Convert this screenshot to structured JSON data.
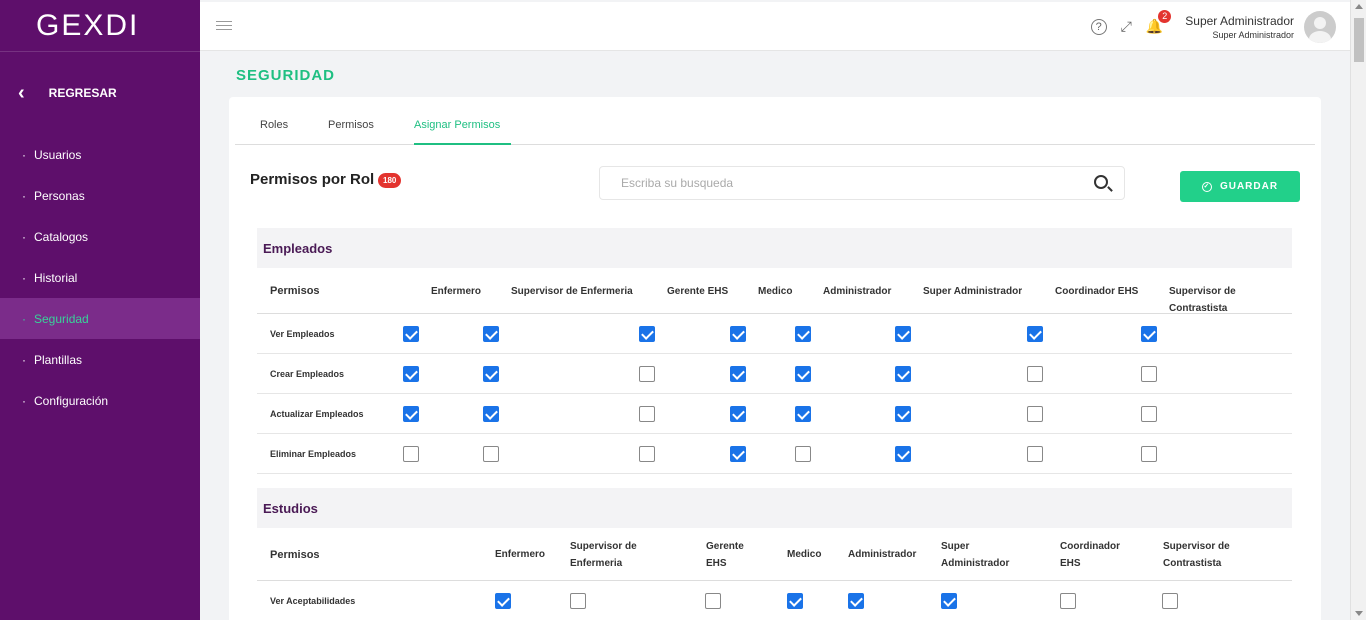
{
  "brand": {
    "logo_text": "GEXDI"
  },
  "sidebar": {
    "back_label": "REGRESAR",
    "items": [
      {
        "label": "Usuarios",
        "active": false
      },
      {
        "label": "Personas",
        "active": false
      },
      {
        "label": "Catalogos",
        "active": false
      },
      {
        "label": "Historial",
        "active": false
      },
      {
        "label": "Seguridad",
        "active": true
      },
      {
        "label": "Plantillas",
        "active": false
      },
      {
        "label": "Configuración",
        "active": false
      }
    ]
  },
  "topbar": {
    "notifications_count": "2",
    "user_name": "Super Administrador",
    "user_role": "Super Administrador"
  },
  "page": {
    "title": "SEGURIDAD"
  },
  "tabs": [
    {
      "label": "Roles",
      "active": false
    },
    {
      "label": "Permisos",
      "active": false
    },
    {
      "label": "Asignar Permisos",
      "active": true
    }
  ],
  "section": {
    "title": "Permisos por Rol",
    "count": "180",
    "search_placeholder": "Escriba su busqueda",
    "save_label": "GUARDAR"
  },
  "groups": [
    {
      "title": "Empleados",
      "perm_header": "Permisos",
      "roles": [
        "Enfermero",
        "Supervisor de Enfermeria",
        "Gerente EHS",
        "Medico",
        "Administrador",
        "Super Administrador",
        "Coordinador EHS",
        "Supervisor de Contrastista"
      ],
      "rows": [
        {
          "label": "Ver Empleados",
          "checks": [
            true,
            true,
            true,
            true,
            true,
            true,
            true,
            true
          ]
        },
        {
          "label": "Crear Empleados",
          "checks": [
            true,
            true,
            false,
            true,
            true,
            true,
            false,
            false
          ]
        },
        {
          "label": "Actualizar Empleados",
          "checks": [
            true,
            true,
            false,
            true,
            true,
            true,
            false,
            false
          ]
        },
        {
          "label": "Eliminar Empleados",
          "checks": [
            false,
            false,
            false,
            true,
            false,
            true,
            false,
            false
          ]
        }
      ]
    },
    {
      "title": "Estudios",
      "perm_header": "Permisos",
      "roles": [
        [
          "Enfermero"
        ],
        [
          "Supervisor de",
          "Enfermeria"
        ],
        [
          "Gerente",
          "EHS"
        ],
        [
          "Medico"
        ],
        [
          "Administrador"
        ],
        [
          "Super",
          "Administrador"
        ],
        [
          "Coordinador",
          "EHS"
        ],
        [
          "Supervisor de",
          "Contrastista"
        ]
      ],
      "rows": [
        {
          "label": "Ver Aceptabilidades",
          "checks": [
            true,
            false,
            false,
            true,
            true,
            true,
            false,
            false
          ]
        }
      ]
    }
  ],
  "colors": {
    "sidebar_bg": "#5e0f6b",
    "accent": "#1fbf82",
    "checkbox": "#1a73e8",
    "badge": "#e3342f"
  }
}
